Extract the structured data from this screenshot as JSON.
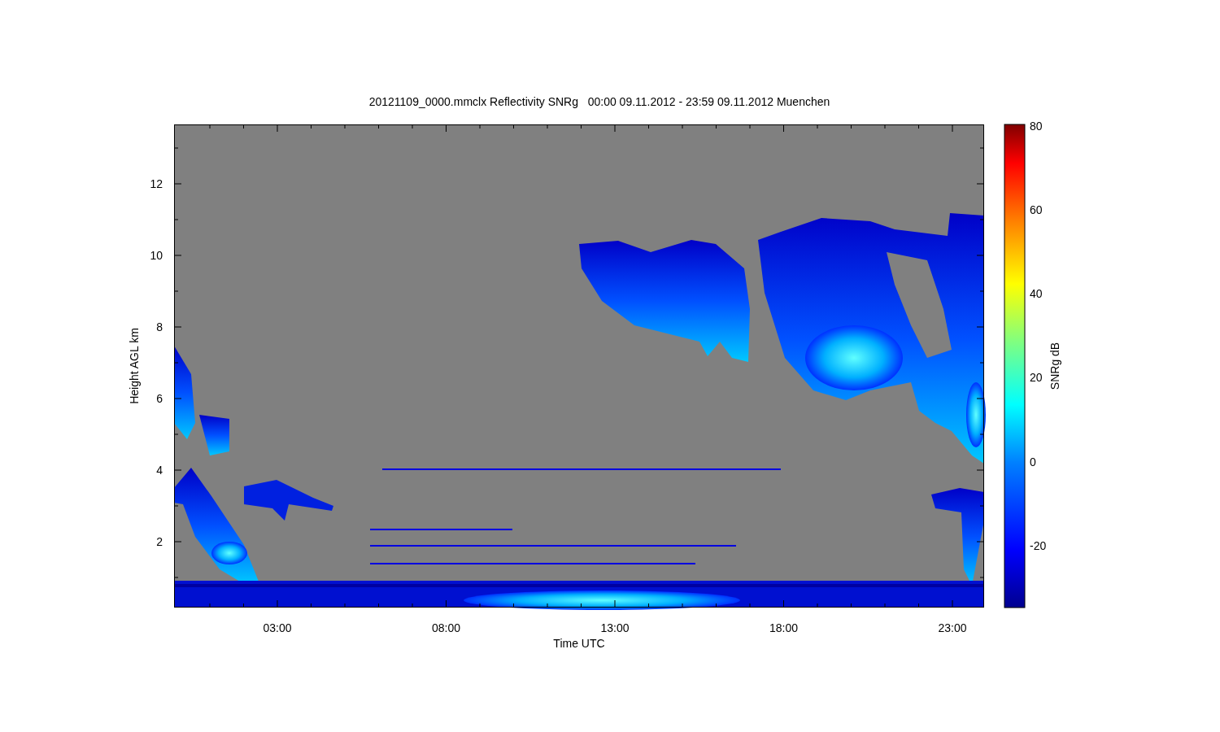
{
  "plot": {
    "title": "20121109_0000.mmclx Reflectivity SNRg   00:00 09.11.2012 - 23:59 09.11.2012 Muenchen",
    "y_axis": {
      "label": "Height AGL km",
      "ticks": [
        "12",
        "10",
        "8",
        "6",
        "4",
        "2"
      ]
    },
    "x_axis": {
      "label": "Time UTC",
      "ticks": [
        "03:00",
        "08:00",
        "13:00",
        "18:00",
        "23:00"
      ]
    },
    "colorbar": {
      "label": "SNRg dB",
      "ticks": [
        "80",
        "60",
        "40",
        "20",
        "0",
        "-20"
      ]
    }
  }
}
